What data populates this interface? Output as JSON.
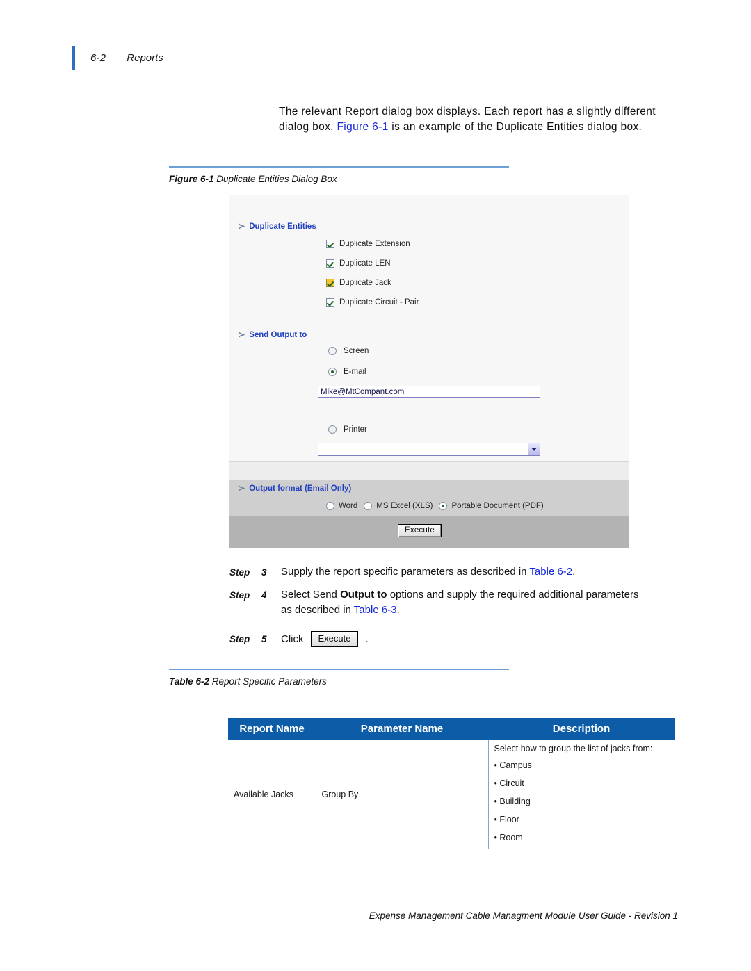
{
  "header": {
    "folio": "6-2",
    "title": "Reports"
  },
  "intro": {
    "part1": "The relevant Report dialog box displays. Each report has a slightly different dialog box. ",
    "xref": "Figure 6-1",
    "part2": " is an example of the Duplicate Entities dialog box."
  },
  "figure_caption": {
    "label": "Figure 6-1",
    "text": "Duplicate Entities Dialog Box"
  },
  "dialog": {
    "sections": {
      "duplicate_entities": "Duplicate Entities",
      "send_output_to": "Send Output to",
      "output_format": "Output format (Email Only)"
    },
    "arrow_glyph": "≻",
    "checkboxes": [
      {
        "label": "Duplicate Extension",
        "checked": true,
        "focused": false
      },
      {
        "label": "Duplicate LEN",
        "checked": true,
        "focused": false
      },
      {
        "label": "Duplicate Jack",
        "checked": true,
        "focused": true
      },
      {
        "label": "Duplicate Circuit - Pair",
        "checked": true,
        "focused": false
      }
    ],
    "output_targets": [
      {
        "label": "Screen",
        "selected": false
      },
      {
        "label": "E-mail",
        "selected": true
      },
      {
        "label": "Printer",
        "selected": false
      }
    ],
    "email_value": "Mike@MtCompant.com",
    "printer_value": "",
    "format_options": [
      {
        "label": "Word",
        "selected": false
      },
      {
        "label": "MS Excel (XLS)",
        "selected": false
      },
      {
        "label": "Portable Document (PDF)",
        "selected": true
      }
    ],
    "execute_label": "Execute",
    "colors": {
      "section_heading": "#1f3fbf",
      "focus_checkbox": "#f4c430",
      "check_mark": "#1d6b1d"
    }
  },
  "steps": [
    {
      "label": "Step",
      "number": "3",
      "text_part1": "Supply the report specific parameters as described in ",
      "xref": "Table 6-2",
      "text_part2": "."
    },
    {
      "label": "Step",
      "number": "4",
      "text_part1": "Select Send ",
      "bold": "Output to",
      "text_part2": " options and supply the required additional parameters as described in ",
      "xref": "Table 6-3",
      "text_part3": "."
    },
    {
      "label": "Step",
      "number": "5",
      "text_part1": "Click",
      "button": "Execute",
      "text_part2": "."
    }
  ],
  "table_caption": {
    "label": "Table 6-2",
    "text": "Report Specific Parameters"
  },
  "table": {
    "headers": [
      "Report Name",
      "Parameter Name",
      "Description"
    ],
    "header_color": "#0d5ca8",
    "rows": [
      {
        "report_name": "Available Jacks",
        "parameter_name": "Group By",
        "description_intro": "Select how to group the list of jacks from:",
        "description_items": [
          "Campus",
          "Circuit",
          "Building",
          "Floor",
          "Room"
        ]
      }
    ]
  },
  "footer": {
    "text": "Expense Management Cable Managment Module User Guide - Revision 1"
  }
}
